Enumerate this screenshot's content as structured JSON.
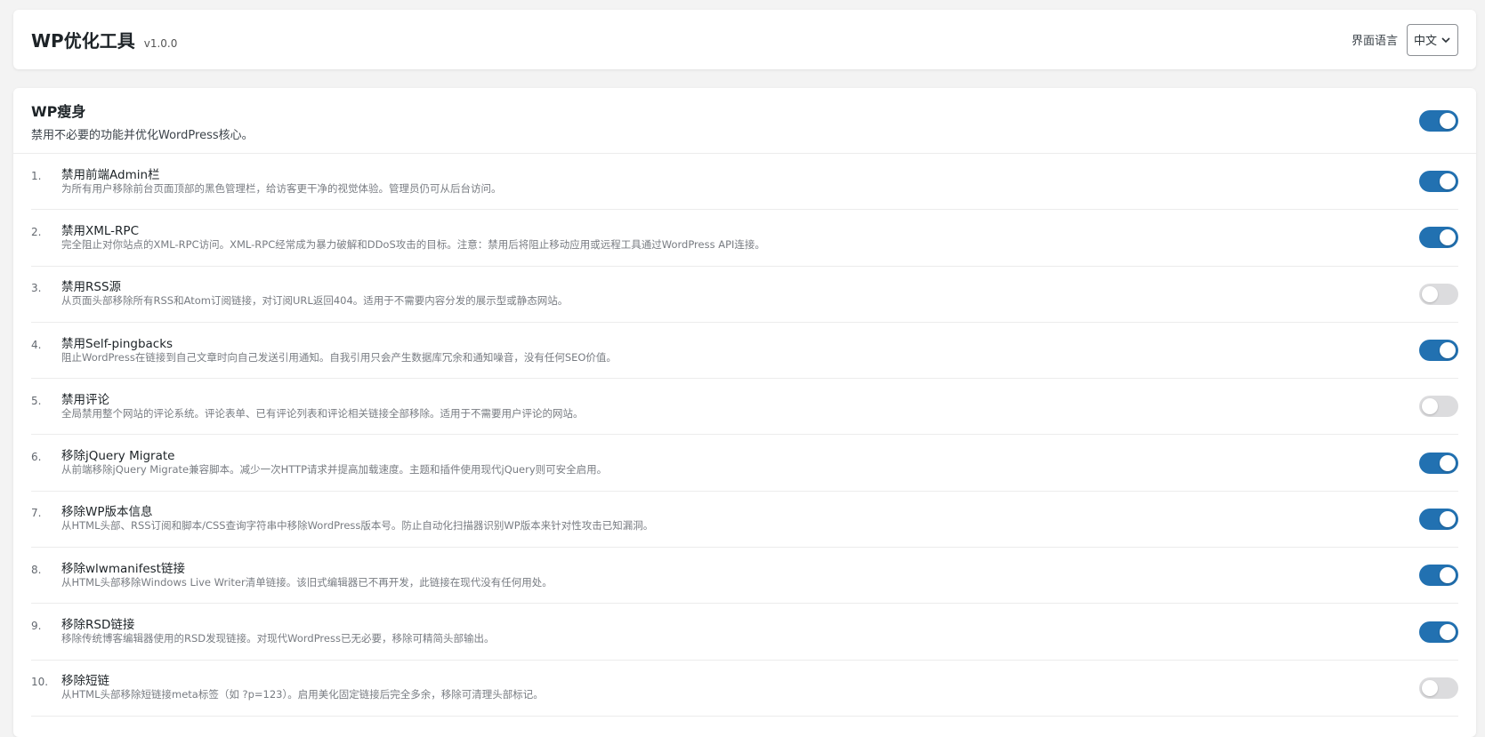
{
  "header": {
    "title": "WP优化工具",
    "version": "v1.0.0",
    "language_label": "界面语言",
    "language_value": "中文"
  },
  "section": {
    "title": "WP瘦身",
    "description": "禁用不必要的功能并优化WordPress核心。",
    "enabled": true
  },
  "items": [
    {
      "num": "1.",
      "title": "禁用前端Admin栏",
      "desc": "为所有用户移除前台页面顶部的黑色管理栏，给访客更干净的视觉体验。管理员仍可从后台访问。",
      "enabled": true
    },
    {
      "num": "2.",
      "title": "禁用XML-RPC",
      "desc": "完全阻止对你站点的XML-RPC访问。XML-RPC经常成为暴力破解和DDoS攻击的目标。注意：禁用后将阻止移动应用或远程工具通过WordPress API连接。",
      "enabled": true
    },
    {
      "num": "3.",
      "title": "禁用RSS源",
      "desc": "从页面头部移除所有RSS和Atom订阅链接，对订阅URL返回404。适用于不需要内容分发的展示型或静态网站。",
      "enabled": false
    },
    {
      "num": "4.",
      "title": "禁用Self-pingbacks",
      "desc": "阻止WordPress在链接到自己文章时向自己发送引用通知。自我引用只会产生数据库冗余和通知噪音，没有任何SEO价值。",
      "enabled": true
    },
    {
      "num": "5.",
      "title": "禁用评论",
      "desc": "全局禁用整个网站的评论系统。评论表单、已有评论列表和评论相关链接全部移除。适用于不需要用户评论的网站。",
      "enabled": false
    },
    {
      "num": "6.",
      "title": "移除jQuery Migrate",
      "desc": "从前端移除jQuery Migrate兼容脚本。减少一次HTTP请求并提高加载速度。主题和插件使用现代jQuery则可安全启用。",
      "enabled": true
    },
    {
      "num": "7.",
      "title": "移除WP版本信息",
      "desc": "从HTML头部、RSS订阅和脚本/CSS查询字符串中移除WordPress版本号。防止自动化扫描器识别WP版本来针对性攻击已知漏洞。",
      "enabled": true
    },
    {
      "num": "8.",
      "title": "移除wlwmanifest链接",
      "desc": "从HTML头部移除Windows Live Writer清单链接。该旧式编辑器已不再开发，此链接在现代没有任何用处。",
      "enabled": true
    },
    {
      "num": "9.",
      "title": "移除RSD链接",
      "desc": "移除传统博客编辑器使用的RSD发现链接。对现代WordPress已无必要，移除可精简头部输出。",
      "enabled": true
    },
    {
      "num": "10.",
      "title": "移除短链",
      "desc": "从HTML头部移除短链接meta标签（如 ?p=123）。启用美化固定链接后完全多余，移除可清理头部标记。",
      "enabled": false
    }
  ],
  "colors": {
    "accent": "#2271b1",
    "toggle_off": "#dcdcde"
  },
  "icons": {
    "language_select": "chevron-down-icon"
  }
}
